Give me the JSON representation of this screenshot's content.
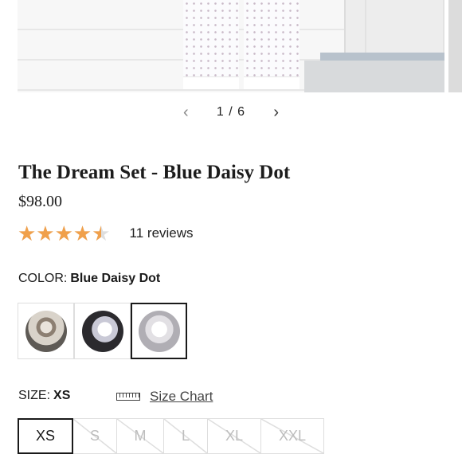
{
  "gallery": {
    "current": "1",
    "separator": "/",
    "total": "6",
    "prev_icon": "chevron-left-icon",
    "next_icon": "chevron-right-icon"
  },
  "product": {
    "title": "The Dream Set - Blue Daisy Dot",
    "price": "$98.00",
    "rating": 4.5,
    "rating_max": 5,
    "reviews": "11 reviews",
    "star_color": "#f0a04b"
  },
  "color": {
    "label": "COLOR:",
    "value": "Blue Daisy Dot",
    "swatches": [
      "swatch-1",
      "swatch-2",
      "swatch-3"
    ],
    "selected_index": 2
  },
  "size": {
    "label": "SIZE:",
    "value": "XS",
    "size_chart_label": "Size Chart",
    "ruler_icon": "ruler-icon",
    "options": [
      {
        "label": "XS",
        "available": true,
        "selected": true
      },
      {
        "label": "S",
        "available": false,
        "selected": false
      },
      {
        "label": "M",
        "available": false,
        "selected": false
      },
      {
        "label": "L",
        "available": false,
        "selected": false
      },
      {
        "label": "XL",
        "available": false,
        "selected": false
      },
      {
        "label": "XXL",
        "available": false,
        "selected": false
      }
    ]
  }
}
